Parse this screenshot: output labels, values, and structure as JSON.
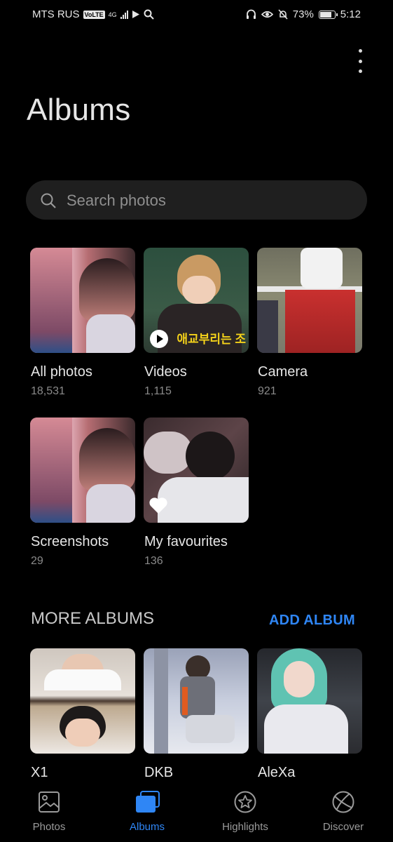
{
  "status_bar": {
    "carrier": "MTS RUS",
    "volte": "VoLTE",
    "network": "4G",
    "battery": "73%",
    "time": "5:12"
  },
  "header": {
    "title": "Albums"
  },
  "search": {
    "placeholder": "Search photos"
  },
  "albums": [
    {
      "name": "All photos",
      "count": "18,531"
    },
    {
      "name": "Videos",
      "count": "1,115"
    },
    {
      "name": "Camera",
      "count": "921"
    },
    {
      "name": "Screenshots",
      "count": "29"
    },
    {
      "name": "My favourites",
      "count": "136"
    }
  ],
  "more_albums": {
    "title": "MORE ALBUMS",
    "add_label": "ADD ALBUM",
    "items": [
      {
        "name": "X1"
      },
      {
        "name": "DKB"
      },
      {
        "name": "AleXa"
      }
    ]
  },
  "nav": {
    "items": [
      {
        "label": "Photos",
        "icon": "image-icon"
      },
      {
        "label": "Albums",
        "icon": "albums-icon",
        "active": true
      },
      {
        "label": "Highlights",
        "icon": "star-circle-icon"
      },
      {
        "label": "Discover",
        "icon": "discover-icon"
      }
    ]
  },
  "colors": {
    "accent": "#2f86f5",
    "background": "#000000",
    "search_bg": "#1f1f1f"
  }
}
